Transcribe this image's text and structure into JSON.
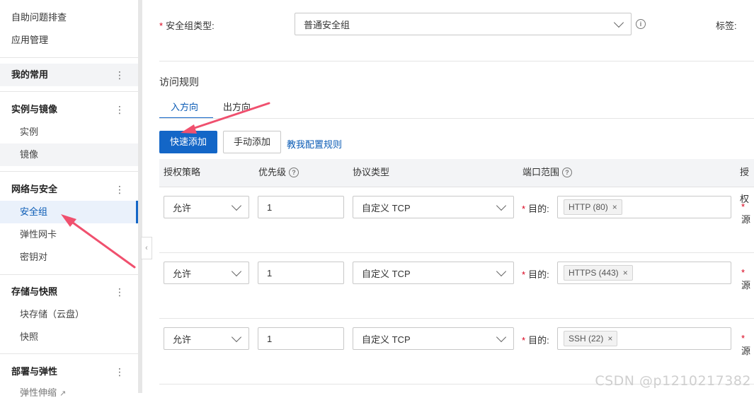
{
  "sidebar": {
    "top_items": [
      "自助问题排查",
      "应用管理"
    ],
    "favorites": {
      "label": "我的常用",
      "more": "⋮"
    },
    "groups": [
      {
        "label": "实例与镜像",
        "more": "⋮",
        "items": [
          "实例",
          "镜像"
        ]
      },
      {
        "label": "网络与安全",
        "more": "⋮",
        "items": [
          "安全组",
          "弹性网卡",
          "密钥对"
        ]
      },
      {
        "label": "存储与快照",
        "more": "⋮",
        "items": [
          "块存储（云盘）",
          "快照"
        ]
      },
      {
        "label": "部署与弹性",
        "more": "⋮",
        "items": [
          "弹性伸缩"
        ]
      }
    ],
    "collapse_glyph": "‹"
  },
  "form": {
    "sg_type_label": "安全组类型:",
    "sg_type_value": "普通安全组",
    "tags_label": "标签:",
    "info_glyph": "i"
  },
  "rules": {
    "section_title": "访问规则",
    "tabs": [
      "入方向",
      "出方向"
    ],
    "active_tab": 0,
    "buttons": {
      "quick_add": "快速添加",
      "manual_add": "手动添加",
      "help_link": "教我配置规则"
    },
    "columns": [
      "授权策略",
      "优先级",
      "协议类型",
      "端口范围",
      "授权"
    ],
    "dest_label": "目的:",
    "source_label": "源",
    "rows": [
      {
        "policy": "允许",
        "priority": "1",
        "protocol": "自定义 TCP",
        "port_tag": "HTTP (80)"
      },
      {
        "policy": "允许",
        "priority": "1",
        "protocol": "自定义 TCP",
        "port_tag": "HTTPS (443)"
      },
      {
        "policy": "允许",
        "priority": "1",
        "protocol": "自定义 TCP",
        "port_tag": "SSH (22)"
      }
    ]
  },
  "watermark": "CSDN @p1210217382",
  "colors": {
    "primary": "#1366c7",
    "annotation_arrow": "#f0506e",
    "required": "#d9001b"
  }
}
